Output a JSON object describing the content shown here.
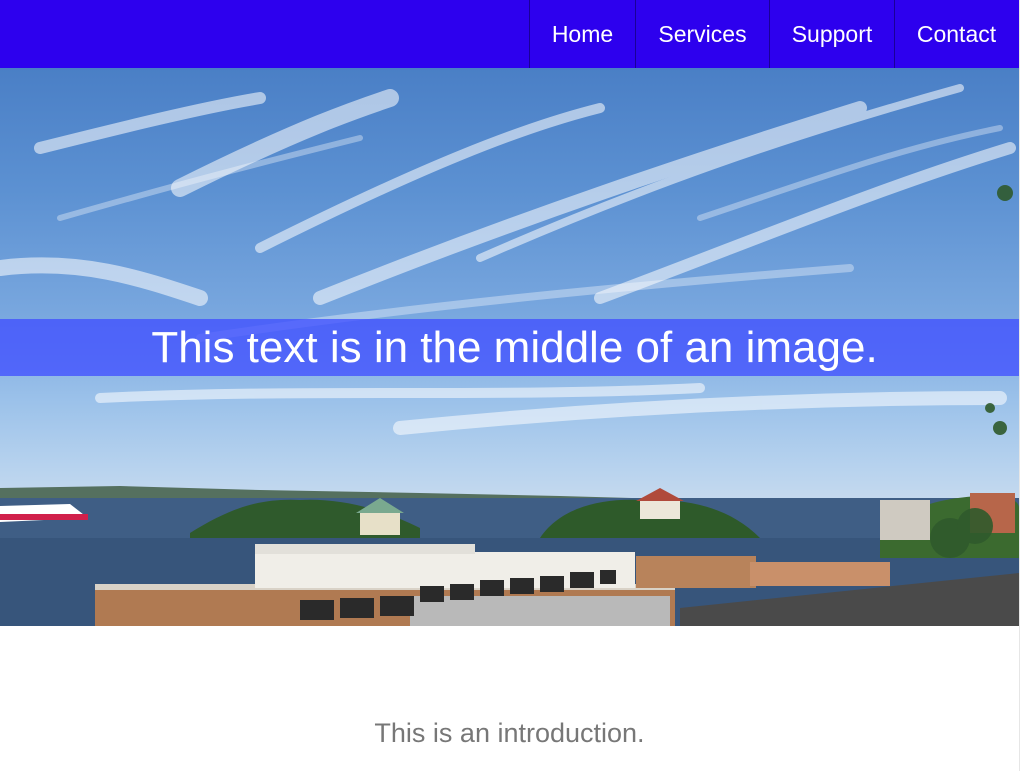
{
  "nav": {
    "items": [
      {
        "label": "Home"
      },
      {
        "label": "Services"
      },
      {
        "label": "Support"
      },
      {
        "label": "Contact"
      }
    ]
  },
  "hero": {
    "caption": "This text is in the middle of an image."
  },
  "intro": {
    "text": "This is an introduction."
  },
  "colors": {
    "navbar": "#2d00ee",
    "caption_band": "#4050ff",
    "intro_text": "#777777"
  }
}
